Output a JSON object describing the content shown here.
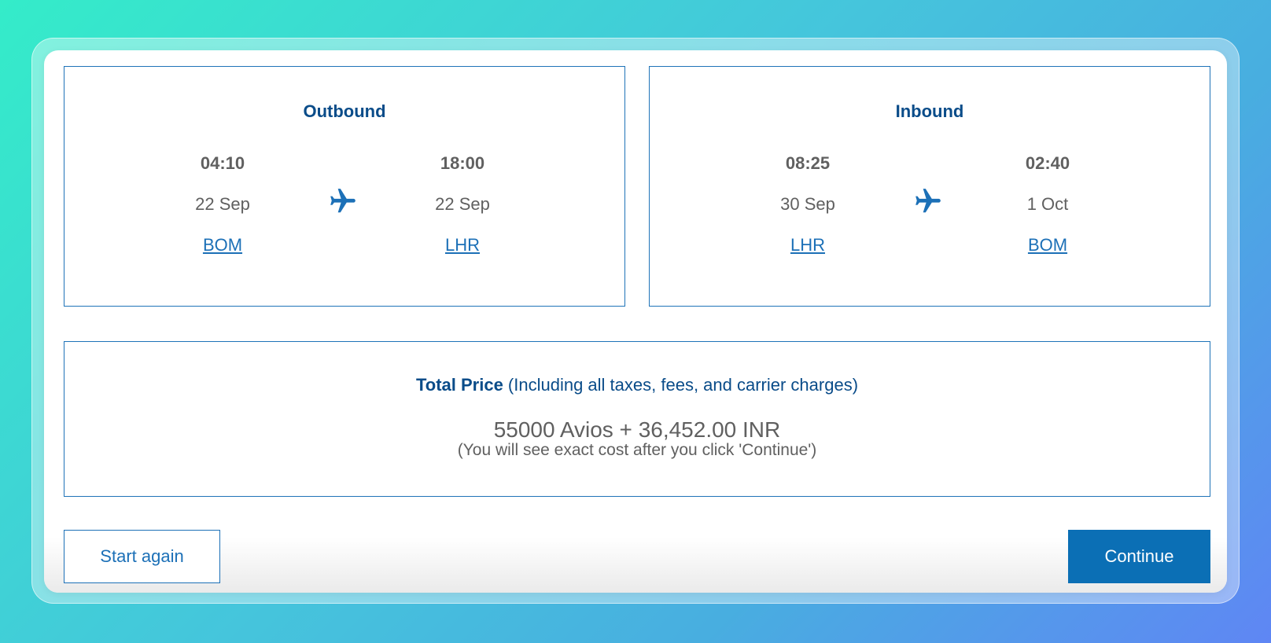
{
  "outbound": {
    "title": "Outbound",
    "departure": {
      "time": "04:10",
      "date": "22 Sep",
      "airport": "BOM"
    },
    "arrival": {
      "time": "18:00",
      "date": "22 Sep",
      "airport": "LHR"
    }
  },
  "inbound": {
    "title": "Inbound",
    "departure": {
      "time": "08:25",
      "date": "30 Sep",
      "airport": "LHR"
    },
    "arrival": {
      "time": "02:40",
      "date": "1 Oct",
      "airport": "BOM"
    }
  },
  "price": {
    "label": "Total Price",
    "qualifier": " (Including all taxes, fees, and carrier charges)",
    "amount": "55000 Avios + 36,452.00 INR",
    "note": "(You will see exact cost after you click 'Continue')"
  },
  "actions": {
    "start_again": "Start again",
    "continue": "Continue"
  },
  "icons": {
    "flight": "airplane-icon"
  },
  "colors": {
    "accent": "#1c70b7",
    "heading": "#0a4c89",
    "button": "#0b6fb5",
    "text": "#606060"
  }
}
